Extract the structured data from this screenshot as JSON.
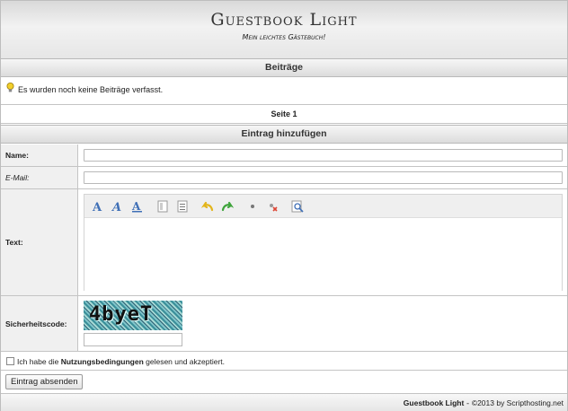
{
  "header": {
    "title": "Guestbook Light",
    "subtitle": "Mein leichtes Gästebuch!"
  },
  "posts": {
    "heading": "Beiträge",
    "info": "Es wurden noch keine Beiträge verfasst.",
    "page": "Seite 1"
  },
  "form": {
    "heading": "Eintrag hinzufügen",
    "name_label": "Name:",
    "email_label": "E-Mail:",
    "text_label": "Text:",
    "captcha_label": "Sicherheitscode:",
    "captcha_text": "4byeT",
    "terms_prefix": "Ich habe die ",
    "terms_link": "Nutzungsbedingungen",
    "terms_suffix": " gelesen und akzeptiert.",
    "submit_label": "Eintrag absenden"
  },
  "toolbar_icons": [
    "font-bold-icon",
    "font-italic-icon",
    "font-underline-icon",
    "align-left-icon",
    "list-icon",
    "undo-icon",
    "redo-icon",
    "bullet-icon",
    "clear-format-icon",
    "preview-icon"
  ],
  "footer": {
    "brand": "Guestbook Light",
    "sep": " - ",
    "copyright": "©2013 by Scripthosting.net"
  },
  "colors": {
    "bar_gradient_top": "#f6f6f6",
    "bar_gradient_bottom": "#dcdcdc",
    "border": "#c4c4c4",
    "icon_blue": "#3f6fb6",
    "icon_yellow": "#e3b51b",
    "icon_green": "#3ea43b"
  }
}
